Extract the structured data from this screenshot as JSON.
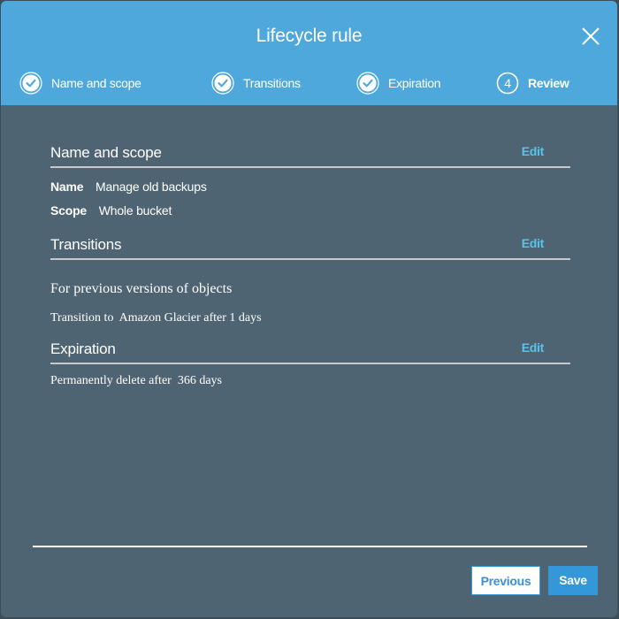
{
  "dialog": {
    "title": "Lifecycle rule",
    "close_icon": "close-icon"
  },
  "steps": [
    {
      "label": "Name and scope",
      "state": "completed",
      "icon": "check-circle-icon"
    },
    {
      "label": "Transitions",
      "state": "completed",
      "icon": "check-circle-icon"
    },
    {
      "label": "Expiration",
      "state": "completed",
      "icon": "check-circle-icon"
    },
    {
      "label": "Review",
      "state": "active",
      "number": "4",
      "icon": "numbered-circle-icon"
    }
  ],
  "sections": {
    "name_scope": {
      "title": "Name and scope",
      "edit_label": "Edit",
      "name_key": "Name",
      "name_value": "Manage old backups",
      "scope_key": "Scope",
      "scope_value": "Whole bucket"
    },
    "transitions": {
      "title": "Transitions",
      "edit_label": "Edit",
      "subheading": "For previous versions of objects",
      "rule_text": "Transition to  Amazon Glacier after 1 days"
    },
    "expiration": {
      "title": "Expiration",
      "edit_label": "Edit",
      "rule_text": "Permanently delete after  366 days"
    }
  },
  "footer": {
    "previous_label": "Previous",
    "save_label": "Save"
  },
  "colors": {
    "header_bg": "#4fa8dc",
    "body_bg": "#4f6472",
    "link": "#58c3ee",
    "primary_button": "#3498d8"
  }
}
